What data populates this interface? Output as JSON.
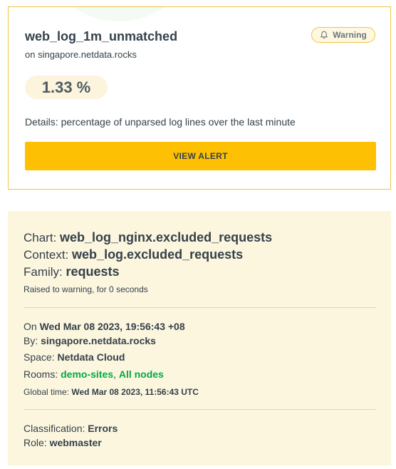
{
  "alert": {
    "name": "web_log_1m_unmatched",
    "host": "on singapore.netdata.rocks",
    "status": "Warning",
    "value": "1.33 %",
    "details": "Details: percentage of unparsed log lines over the last minute",
    "button_label": "VIEW ALERT",
    "status_icon": "bell-icon"
  },
  "info": {
    "chart_label": "Chart:",
    "chart_value": "web_log_nginx.excluded_requests",
    "context_label": "Context:",
    "context_value": "web_log.excluded_requests",
    "family_label": "Family:",
    "family_value": "requests",
    "raised_text": "Raised to warning, for 0 seconds",
    "on_label": "On",
    "on_value": "Wed Mar 08 2023, 19:56:43 +08",
    "by_label": "By:",
    "by_value": "singapore.netdata.rocks",
    "space_label": "Space:",
    "space_value": "Netdata Cloud",
    "rooms_label": "Rooms:",
    "rooms": [
      "demo-sites",
      "All nodes"
    ],
    "rooms_separator": ", ",
    "global_time_label": "Global time:",
    "global_time_value": "Wed Mar 08 2023, 11:56:43 UTC",
    "classification_label": "Classification:",
    "classification_value": "Errors",
    "role_label": "Role:",
    "role_value": "webmaster"
  },
  "colors": {
    "accent_yellow": "#fdc003",
    "badge_border": "#f0c542",
    "panel_bg": "#fcf6df",
    "link_green": "#00ab44",
    "text": "#35414a"
  }
}
